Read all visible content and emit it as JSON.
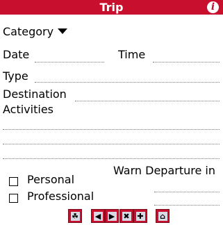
{
  "title_bar": {
    "title": "Trip"
  },
  "form": {
    "category_label": "Category",
    "date_label": "Date",
    "time_label": "Time",
    "type_label": "Type",
    "destination_label": "Destination",
    "activities_label": "Activities",
    "personal_label": "Personal",
    "professional_label": "Professional",
    "warn_label": "Warn Departure in"
  },
  "toolbar": {
    "buttons": [
      {
        "icon": "shield-icon",
        "glyph": "☘"
      },
      {
        "icon": "arrow-left-icon",
        "glyph": "◀"
      },
      {
        "icon": "arrow-right-icon",
        "glyph": "▶"
      },
      {
        "icon": "delete-icon",
        "glyph": "✖"
      },
      {
        "icon": "add-icon",
        "glyph": "✚"
      },
      {
        "icon": "home-icon",
        "glyph": "⌂"
      }
    ]
  },
  "colors": {
    "accent": "#c8102e"
  }
}
